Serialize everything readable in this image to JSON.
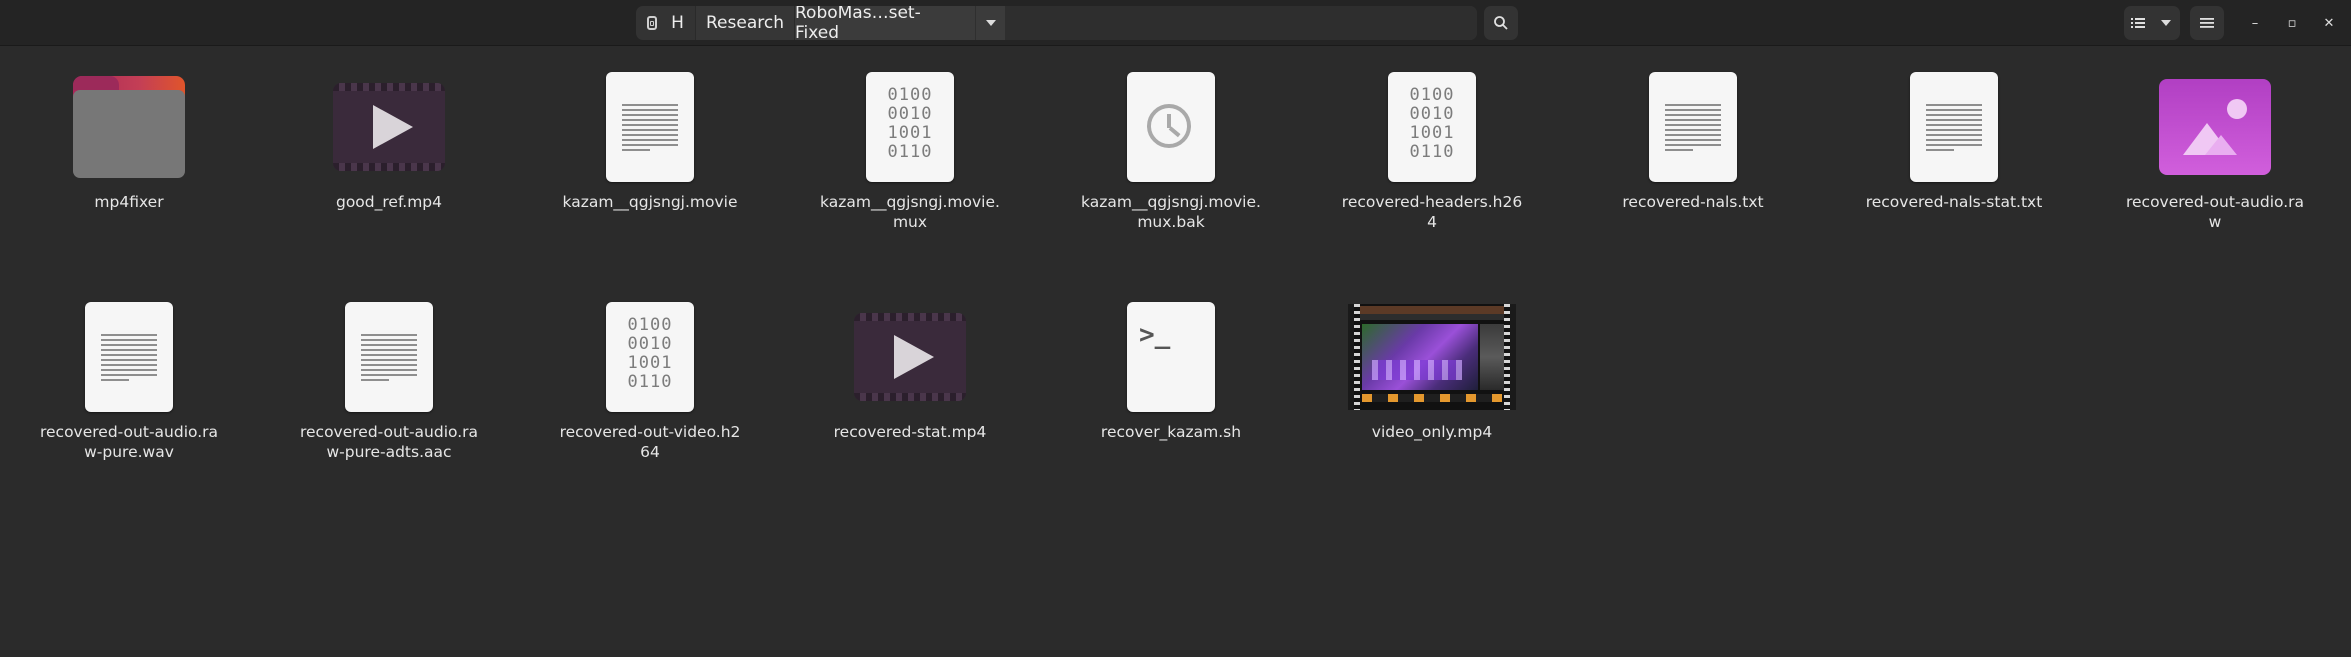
{
  "header": {
    "path": {
      "home_label": "H",
      "segment_research": "Research",
      "segment_current": "RoboMas…set-Fixed"
    },
    "icons": {
      "drive": "drive-icon",
      "dropdown": "chevron-down-icon",
      "search": "search-icon",
      "list_view": "list-view-icon",
      "view_dropdown": "chevron-down-icon",
      "menu": "hamburger-menu-icon",
      "minimize": "minimize-icon",
      "maximize": "maximize-icon",
      "close": "close-icon"
    },
    "window_controls": {
      "minimize": "–",
      "maximize": "▫",
      "close": "✕"
    }
  },
  "colors": {
    "background": "#2b2b2b",
    "headerbar": "#242424",
    "folder_accent": "#e0552b",
    "image_accent": "#c050d0"
  },
  "files": [
    {
      "name": "mp4fixer",
      "type": "folder"
    },
    {
      "name": "good_ref.mp4",
      "type": "video"
    },
    {
      "name": "kazam__qgjsngj.movie",
      "type": "text"
    },
    {
      "name": "kazam__qgjsngj.movie.mux",
      "type": "binary"
    },
    {
      "name": "kazam__qgjsngj.movie.mux.bak",
      "type": "backup"
    },
    {
      "name": "recovered-headers.h264",
      "type": "binary"
    },
    {
      "name": "recovered-nals.txt",
      "type": "text"
    },
    {
      "name": "recovered-nals-stat.txt",
      "type": "text"
    },
    {
      "name": "recovered-out-audio.raw",
      "type": "image"
    },
    {
      "name": "recovered-out-audio.raw-pure.wav",
      "type": "text"
    },
    {
      "name": "recovered-out-audio.raw-pure-adts.aac",
      "type": "text"
    },
    {
      "name": "recovered-out-video.h264",
      "type": "binary"
    },
    {
      "name": "recovered-stat.mp4",
      "type": "video"
    },
    {
      "name": "recover_kazam.sh",
      "type": "script"
    },
    {
      "name": "video_only.mp4",
      "type": "video-thumbnail"
    }
  ],
  "binary_glyph": [
    "0100",
    "0010",
    "1001",
    "0110"
  ],
  "script_glyph": ">_"
}
